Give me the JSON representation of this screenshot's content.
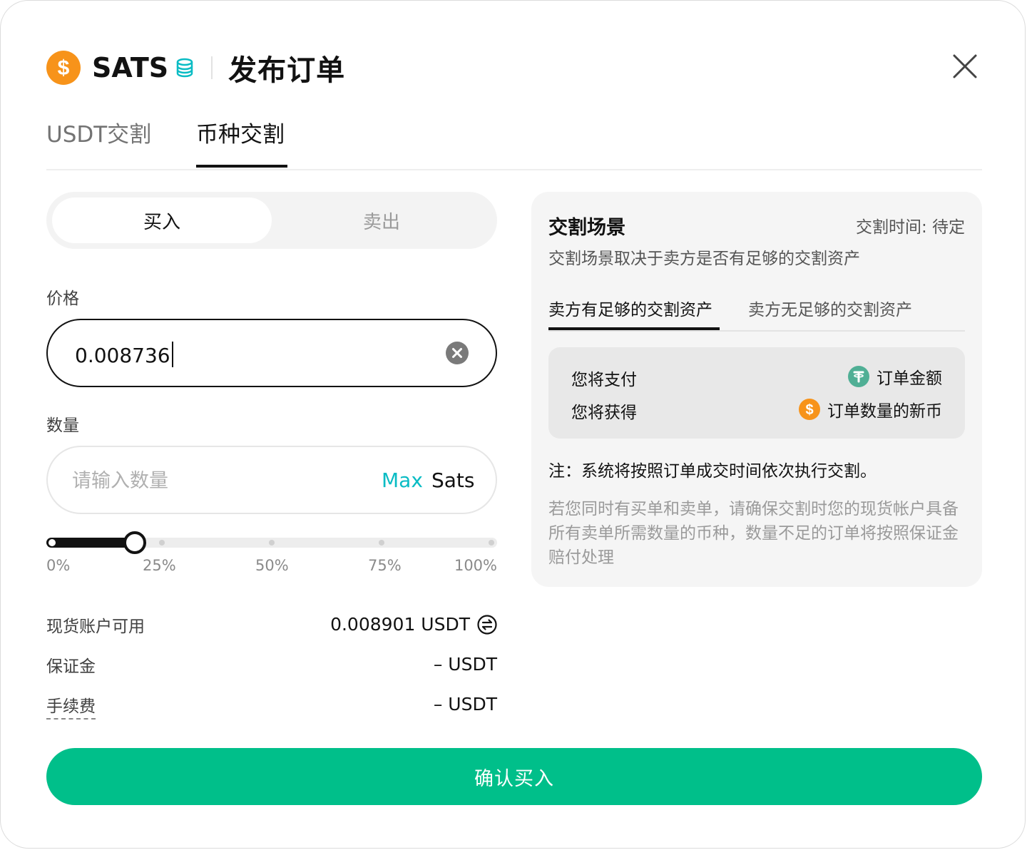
{
  "header": {
    "coin_name": "SATS",
    "coin_icon": "dollar-coin-icon",
    "chain_icon": "database-stack-icon",
    "title": "发布订单",
    "close_icon": "close-icon"
  },
  "tabs": [
    {
      "label": "USDT交割",
      "active": false
    },
    {
      "label": "币种交割",
      "active": true
    }
  ],
  "side_toggle": {
    "buy_label": "买入",
    "sell_label": "卖出",
    "selected": "buy"
  },
  "price": {
    "label": "价格",
    "value": "0.008736",
    "clear_icon": "clear-circle-icon"
  },
  "quantity": {
    "label": "数量",
    "placeholder": "请输入数量",
    "max_label": "Max",
    "unit": "Sats"
  },
  "slider": {
    "value_fraction": 0.18,
    "marks": [
      "0%",
      "25%",
      "50%",
      "75%",
      "100%"
    ]
  },
  "account": {
    "available_label": "现货账户可用",
    "available_value": "0.008901 USDT",
    "swap_icon": "swap-icon",
    "margin_label": "保证金",
    "margin_value": "– USDT",
    "fee_label": "手续费",
    "fee_value": "– USDT"
  },
  "panel": {
    "title": "交割场景",
    "time": "交割时间: 待定",
    "description": "交割场景取决于卖方是否有足够的交割资产",
    "sub_tabs": [
      {
        "label": "卖方有足够的交割资产",
        "active": true
      },
      {
        "label": "卖方无足够的交割资产",
        "active": false
      }
    ],
    "pay_label": "您将支付",
    "pay_value": "订单金额",
    "pay_icon": "tether-icon",
    "receive_label": "您将获得",
    "receive_value": "订单数量的新币",
    "receive_icon": "dollar-coin-icon",
    "note": "注：系统将按照订单成交时间依次执行交割。",
    "warning": "若您同时有买单和卖单，请确保交割时您的现货帐户具备所有卖单所需数量的币种，数量不足的订单将按照保证金赔付处理"
  },
  "confirm_label": "确认买入",
  "colors": {
    "accent": "#00BF8A",
    "coin": "#F7931A",
    "tether": "#50AF95",
    "max": "#0ABCC4",
    "text": "#121212"
  }
}
